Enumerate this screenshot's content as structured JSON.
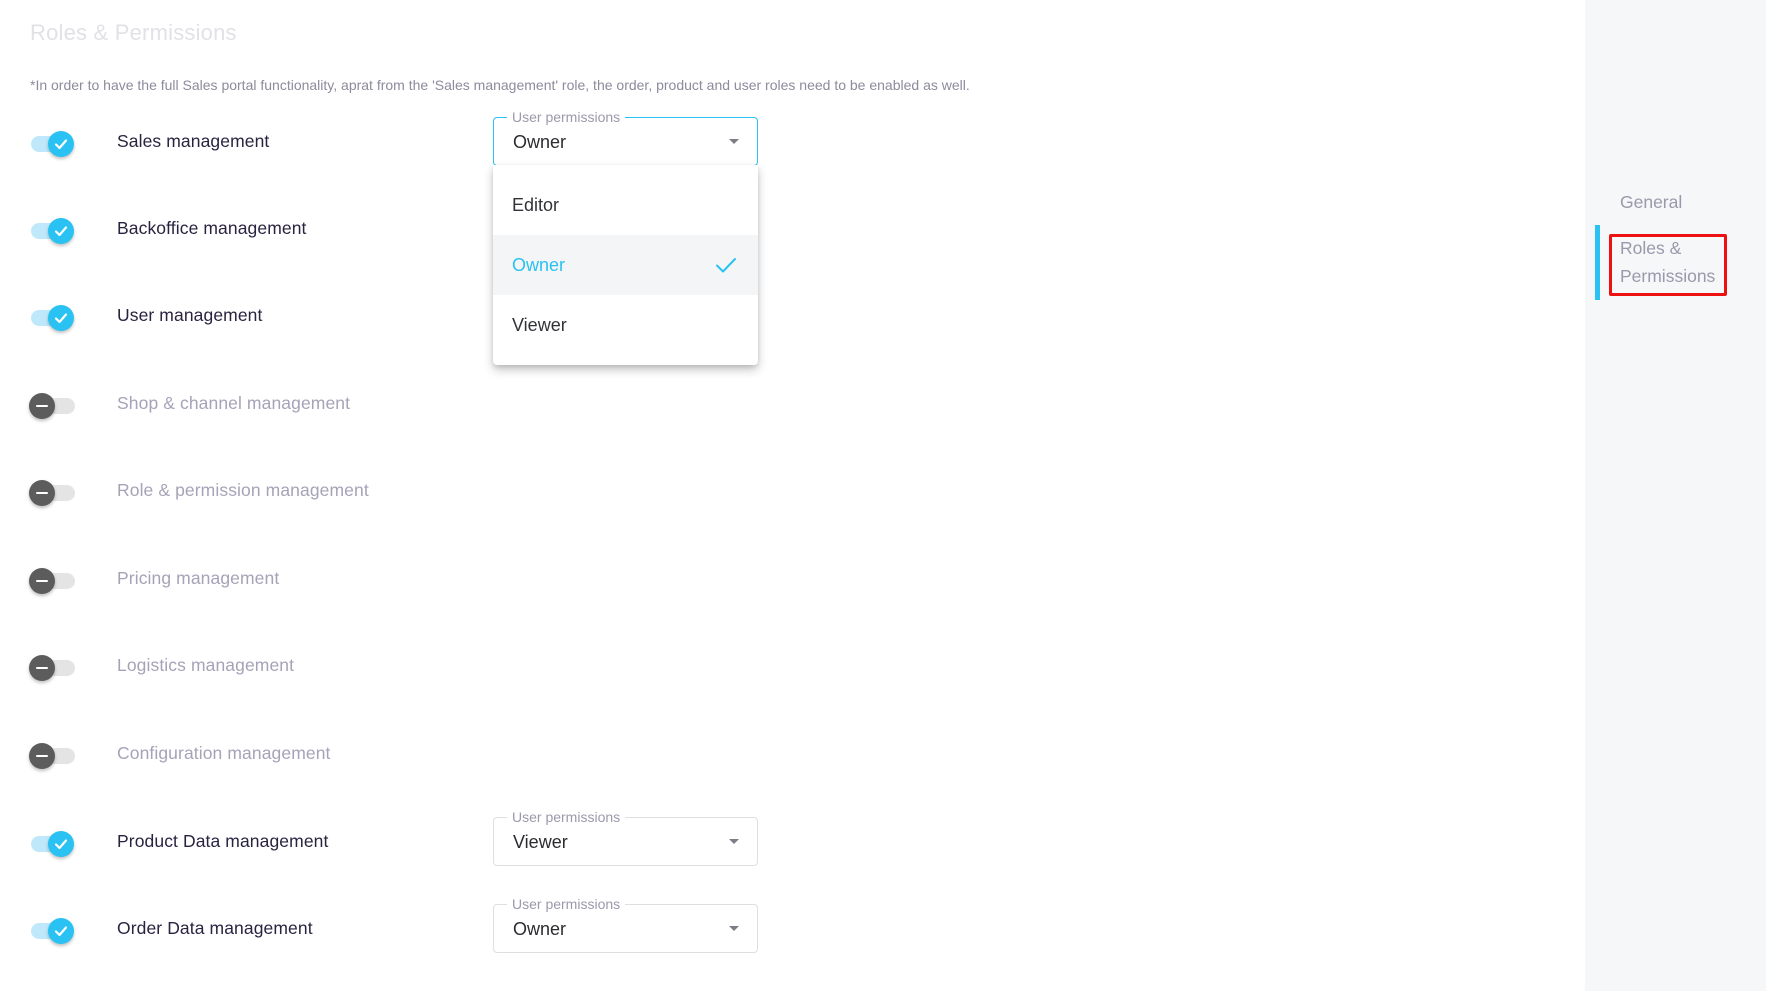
{
  "page": {
    "title": "Roles & Permissions",
    "note": "*In order to have the full Sales portal functionality, aprat from the 'Sales management' role, the order, product and user roles need to be enabled as well."
  },
  "roles": [
    {
      "label": "Sales management",
      "enabled": true,
      "permission": {
        "legend": "User permissions",
        "value": "Owner",
        "open": true
      }
    },
    {
      "label": "Backoffice management",
      "enabled": true
    },
    {
      "label": "User management",
      "enabled": true
    },
    {
      "label": "Shop & channel management",
      "enabled": false
    },
    {
      "label": "Role & permission management",
      "enabled": false
    },
    {
      "label": "Pricing management",
      "enabled": false
    },
    {
      "label": "Logistics management",
      "enabled": false
    },
    {
      "label": "Configuration management",
      "enabled": false
    },
    {
      "label": "Product Data management",
      "enabled": true,
      "permission": {
        "legend": "User permissions",
        "value": "Viewer"
      }
    },
    {
      "label": "Order Data management",
      "enabled": true,
      "permission": {
        "legend": "User permissions",
        "value": "Owner"
      }
    }
  ],
  "dropdown": {
    "options": [
      {
        "label": "Editor",
        "selected": false
      },
      {
        "label": "Owner",
        "selected": true
      },
      {
        "label": "Viewer",
        "selected": false
      }
    ]
  },
  "sidebar": {
    "items": [
      {
        "label": "General",
        "active": false
      },
      {
        "label": "Roles & Permissions",
        "active": true
      }
    ]
  },
  "icons": {
    "toggle_on": "check-icon",
    "toggle_off": "minus-icon",
    "select_caret": "caret-down-icon",
    "selected_option": "check-icon"
  },
  "colors": {
    "accent": "#29c2f2",
    "highlight_box": "#ee1111",
    "toggle_off_knob": "#5c5c5c"
  }
}
